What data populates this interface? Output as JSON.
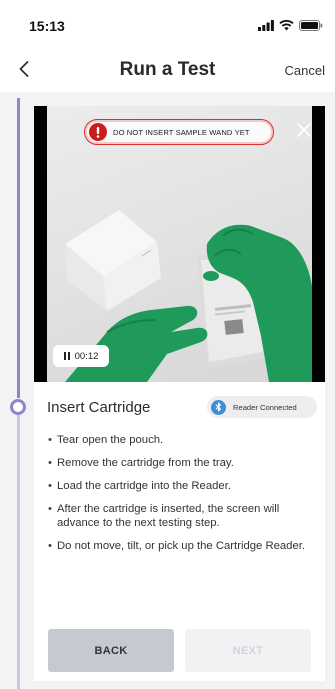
{
  "status_bar": {
    "time": "15:13",
    "icons": [
      "cellular-signal-icon",
      "wifi-icon",
      "battery-icon"
    ]
  },
  "nav": {
    "back_icon": "chevron-left-icon",
    "title": "Run a Test",
    "cancel_label": "Cancel"
  },
  "video": {
    "warning_text": "DO NOT INSERT SAMPLE WAND YET",
    "warning_icon": "exclamation-icon",
    "close_icon": "close-icon",
    "timer": "00:12",
    "timer_icon": "pause-icon"
  },
  "step": {
    "title": "Insert Cartridge",
    "reader_status": "Reader Connected",
    "reader_icon": "bluetooth-icon",
    "instructions": [
      "Tear open the pouch.",
      "Remove the cartridge from the tray.",
      "Load the cartridge into the Reader.",
      "After the cartridge is inserted, the screen will advance to the next testing step.",
      "Do not move, tilt, or pick up the Cartridge Reader."
    ]
  },
  "buttons": {
    "back_label": "BACK",
    "next_label": "NEXT"
  },
  "colors": {
    "timeline_active": "#8d86c9",
    "warning_red": "#c81e1e",
    "reader_blue": "#3b8fd6",
    "glove_green": "#1f9a5a"
  }
}
